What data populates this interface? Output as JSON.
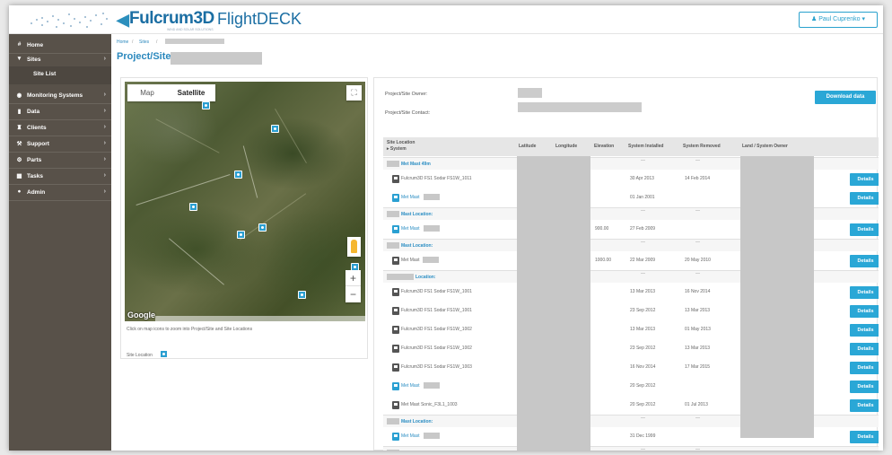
{
  "header": {
    "brand": "Fulcrum3D",
    "brand_tagline": "WIND AND SOLAR SOLUTIONS",
    "product": "FlightDECK",
    "user_label": "♟ Paul Cuprenko ▾"
  },
  "sidebar": {
    "items": [
      {
        "icon": "#",
        "label": "Home",
        "chevron": ""
      },
      {
        "icon": "▼",
        "label": "Sites",
        "chevron": "›"
      },
      {
        "icon": "",
        "label": "Site List",
        "chevron": ""
      },
      {
        "icon": "◉",
        "label": "Monitoring Systems",
        "chevron": "›"
      },
      {
        "icon": "▮",
        "label": "Data",
        "chevron": "›"
      },
      {
        "icon": "♜",
        "label": "Clients",
        "chevron": "›"
      },
      {
        "icon": "⚒",
        "label": "Support",
        "chevron": "›"
      },
      {
        "icon": "⚙",
        "label": "Parts",
        "chevron": "›"
      },
      {
        "icon": "▦",
        "label": "Tasks",
        "chevron": "›"
      },
      {
        "icon": "●",
        "label": "Admin",
        "chevron": "›"
      }
    ]
  },
  "breadcrumb": {
    "home": "Home",
    "sites": "Sites",
    "sep": "/"
  },
  "page_title": "Project/Site:",
  "map": {
    "type_map": "Map",
    "type_satellite": "Satellite",
    "fullscreen_icon": "⛶",
    "zoom_in": "+",
    "zoom_out": "−",
    "google": "Google",
    "hint": "Click on map icons to zoom into Project/Site and Site Locations",
    "legend_label": "Site Location"
  },
  "info": {
    "owner_label": "Project/Site Owner:",
    "contact_label": "Project/Site Contact:",
    "download_label": "Download data"
  },
  "table": {
    "headers": {
      "site_location": "Site Location",
      "system": "▸ System",
      "latitude": "Latitude",
      "longitude": "Longitude",
      "elevation": "Elevation",
      "installed": "System Installed",
      "removed": "System Removed",
      "land_owner": "Land / System Owner"
    },
    "details_label": "Details",
    "rows": [
      {
        "kind": "group",
        "label": "Met Mast 49m",
        "redact_w": 14
      },
      {
        "kind": "system",
        "icon": "dark",
        "name": "Fulcrum3D FS1 Sodar FS1W_1011",
        "elevation": "",
        "installed": "30 Apr 2013",
        "removed": "14 Feb 2014",
        "details": true
      },
      {
        "kind": "system",
        "icon": "blue",
        "name": "Met Mast",
        "redact": true,
        "elevation": "",
        "installed": "01 Jan 2001",
        "removed": "",
        "details": true
      },
      {
        "kind": "group",
        "label": "Mast Location:",
        "redact_w": 14
      },
      {
        "kind": "system",
        "icon": "blue",
        "name": "Met Mast",
        "redact": true,
        "elevation": "900.00",
        "installed": "27 Feb 2009",
        "removed": "",
        "details": true
      },
      {
        "kind": "group",
        "label": "Mast Location:",
        "redact_w": 14
      },
      {
        "kind": "system",
        "icon": "dark",
        "name": "Met Mast",
        "redact": true,
        "elevation": "1000.00",
        "installed": "22 Mar 2009",
        "removed": "20 May 2010",
        "details": true
      },
      {
        "kind": "group",
        "label": "Location:",
        "redact_w": 30
      },
      {
        "kind": "system",
        "icon": "dark",
        "name": "Fulcrum3D FS1 Sodar FS1W_1001",
        "elevation": "",
        "installed": "13 Mar 2013",
        "removed": "16 Nov 2014",
        "details": true
      },
      {
        "kind": "system",
        "icon": "dark",
        "name": "Fulcrum3D FS1 Sodar FS1W_1001",
        "elevation": "",
        "installed": "23 Sep 2012",
        "removed": "13 Mar 2013",
        "details": true
      },
      {
        "kind": "system",
        "icon": "dark",
        "name": "Fulcrum3D FS1 Sodar FS1W_1002",
        "elevation": "",
        "installed": "13 Mar 2013",
        "removed": "01 May 2013",
        "details": true
      },
      {
        "kind": "system",
        "icon": "dark",
        "name": "Fulcrum3D FS1 Sodar FS1W_1002",
        "elevation": "",
        "installed": "23 Sep 2012",
        "removed": "13 Mar 2013",
        "details": true
      },
      {
        "kind": "system",
        "icon": "dark",
        "name": "Fulcrum3D FS1 Sodar FS1W_1003",
        "elevation": "",
        "installed": "16 Nov 2014",
        "removed": "17 Mar 2015",
        "details": true
      },
      {
        "kind": "system",
        "icon": "blue",
        "name": "Met Mast",
        "redact": true,
        "elevation": "",
        "installed": "20 Sep 2012",
        "removed": "",
        "details": true
      },
      {
        "kind": "system",
        "icon": "dark",
        "name": "Met Mast Sonic_F3L1_1003",
        "elevation": "",
        "installed": "20 Sep 2012",
        "removed": "01 Jul 2013",
        "details": true
      },
      {
        "kind": "group",
        "label": "Mast Location:",
        "redact_w": 14
      },
      {
        "kind": "system",
        "icon": "blue",
        "name": "Met Mast",
        "redact": true,
        "elevation": "",
        "installed": "31 Dec 1999",
        "removed": "",
        "details": true
      },
      {
        "kind": "group",
        "label": "Mast Location:",
        "redact_w": 14
      },
      {
        "kind": "system",
        "icon": "dark",
        "name": "Fulcrum3D FS1 Sodar FS1W_1001",
        "elevation": "",
        "installed": "",
        "removed": "",
        "details": true
      }
    ]
  }
}
